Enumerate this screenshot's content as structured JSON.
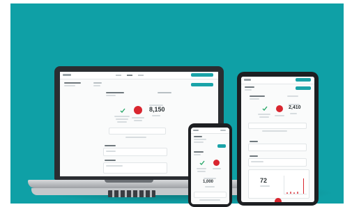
{
  "colors": {
    "background": "#0fa0a6",
    "accent": "#1aa3a8",
    "alert_red": "#d9262f",
    "device_frame": "#1d1f22"
  },
  "laptop": {
    "metric_value": "8,150"
  },
  "tablet": {
    "metric_value": "2,410",
    "stat_value": "72"
  },
  "phone": {
    "metric_value": "1,000"
  }
}
